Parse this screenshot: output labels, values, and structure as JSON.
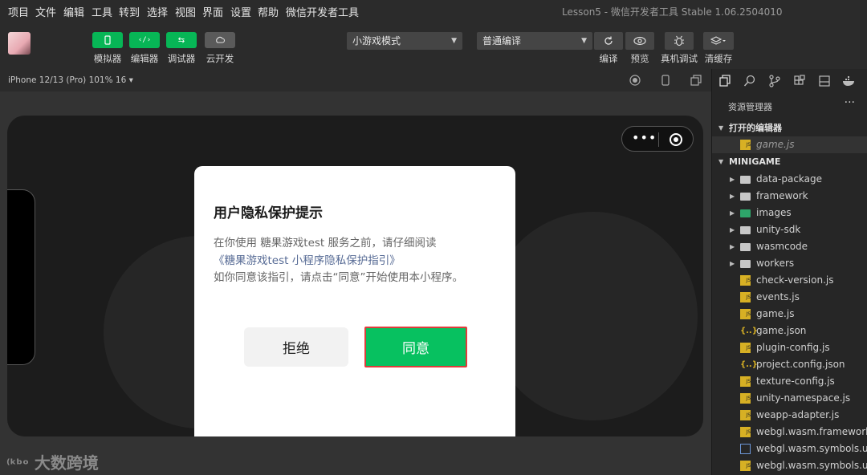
{
  "menubar": {
    "items": [
      "项目",
      "文件",
      "编辑",
      "工具",
      "转到",
      "选择",
      "视图",
      "界面",
      "设置",
      "帮助",
      "微信开发者工具"
    ],
    "title": "Lesson5 - 微信开发者工具 Stable 1.06.2504010"
  },
  "toolbar": {
    "left_buttons": [
      {
        "label": "模拟器",
        "icon": "phone-icon"
      },
      {
        "label": "编辑器",
        "icon": "code-icon"
      },
      {
        "label": "调试器",
        "icon": "debug-icon"
      },
      {
        "label": "云开发",
        "icon": "cloud-icon"
      }
    ],
    "mode_select": "小游戏模式",
    "compile_select": "普通编译",
    "right_buttons": [
      {
        "label": "编译",
        "icon": "refresh-icon"
      },
      {
        "label": "预览",
        "icon": "eye-icon"
      },
      {
        "label": "真机调试",
        "icon": "bug-icon"
      },
      {
        "label": "清缓存",
        "icon": "layers-icon"
      }
    ]
  },
  "simulator": {
    "device": "iPhone 12/13 (Pro) 101% 16 ▾"
  },
  "dialog": {
    "title": "用户隐私保护提示",
    "line1": "在你使用 糖果游戏test 服务之前，请仔细阅读",
    "link": "《糖果游戏test 小程序隐私保护指引》",
    "line3": "如你同意该指引，请点击“同意”开始使用本小程序。",
    "reject": "拒绝",
    "agree": "同意"
  },
  "watermark": "大数跨境",
  "explorer": {
    "header": "资源管理器",
    "open_editors_label": "打开的编辑器",
    "open_editors": [
      "game.js"
    ],
    "project_label": "MINIGAME",
    "folders": [
      "data-package",
      "framework",
      "images",
      "unity-sdk",
      "wasmcode",
      "workers"
    ],
    "files": [
      {
        "name": "check-version.js",
        "type": "js"
      },
      {
        "name": "events.js",
        "type": "js"
      },
      {
        "name": "game.js",
        "type": "js"
      },
      {
        "name": "game.json",
        "type": "json"
      },
      {
        "name": "plugin-config.js",
        "type": "js"
      },
      {
        "name": "project.config.json",
        "type": "json"
      },
      {
        "name": "texture-config.js",
        "type": "js"
      },
      {
        "name": "unity-namespace.js",
        "type": "js"
      },
      {
        "name": "weapp-adapter.js",
        "type": "js"
      },
      {
        "name": "webgl.wasm.framework...",
        "type": "js"
      },
      {
        "name": "webgl.wasm.symbols.u...",
        "type": "file"
      },
      {
        "name": "webgl.wasm.symbols.u...",
        "type": "js"
      }
    ]
  },
  "colors": {
    "accent_green": "#07c160",
    "link_blue": "#576b95",
    "highlight_border": "#e03b3b"
  }
}
